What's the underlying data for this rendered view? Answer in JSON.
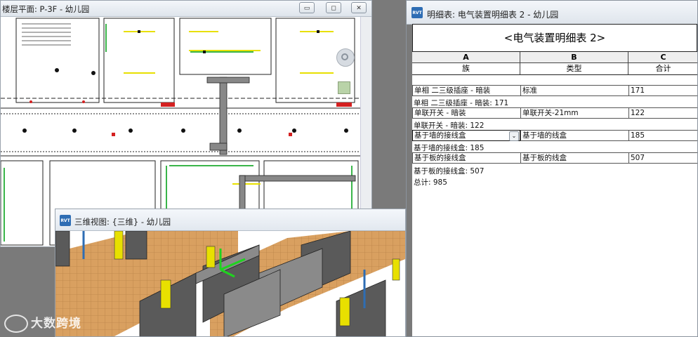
{
  "plan_window": {
    "title": "楼层平面: P-3F - 幼儿园",
    "min_icon": "minimize-icon",
    "max_icon": "restore-icon",
    "close_icon": "close-icon",
    "min_glyph": "▭",
    "max_glyph": "◻",
    "close_glyph": "✕"
  },
  "schedule_window": {
    "title": "明细表: 电气装置明细表 2 - 幼儿园",
    "icon_label": "RVT",
    "sheet_title": "<电气装置明细表 2>",
    "columns": [
      {
        "letter": "A",
        "header": "族"
      },
      {
        "letter": "B",
        "header": "类型"
      },
      {
        "letter": "C",
        "header": "合计"
      }
    ],
    "rows": [
      {
        "family": "单相 二三级插座 - 暗装",
        "type": "标准",
        "count": "171",
        "group_total": "单相 二三级插座 - 暗装: 171"
      },
      {
        "family": "单联开关 - 暗装",
        "type": "单联开关-21mm",
        "count": "122",
        "group_total": "单联开关 - 暗装: 122"
      },
      {
        "family": "基于墙的接线盒",
        "type": "基于墙的线盒",
        "count": "185",
        "group_total": "基于墙的接线盒: 185"
      },
      {
        "family": "基于板的接线盒",
        "type": "基于板的线盒",
        "count": "507",
        "group_total": "基于板的接线盒: 507"
      }
    ],
    "grand_total": "总计: 985",
    "combo_glyph": "⌄"
  },
  "view3d_window": {
    "title": "三维视图: {三维} - 幼儿园",
    "icon_label": "RVT"
  },
  "watermark": {
    "text": "大数跨境"
  },
  "colors": {
    "window_bg": "#ffffff",
    "app_bg": "#7a7a7a",
    "wall_gray": "#6f6f6f",
    "floor_tile": "#d9a060",
    "accent_blue": "#2e6db4",
    "plan_green": "#3ab54a",
    "plan_red": "#d42020",
    "plan_yellow": "#e8e000"
  }
}
